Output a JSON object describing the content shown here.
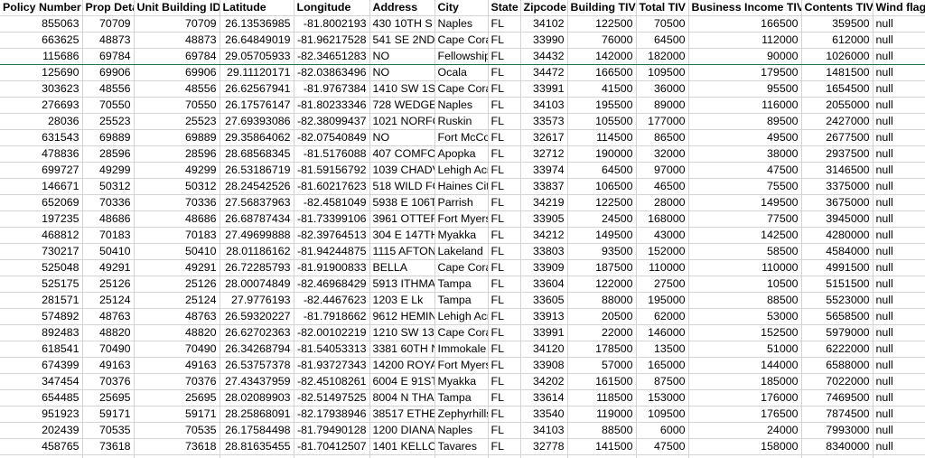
{
  "sheet": {
    "columns": [
      "Policy Number",
      "Prop Deta",
      "Unit Building ID",
      "Latitude",
      "Longitude",
      "Address",
      "City",
      "State",
      "Zipcode",
      "Building TIV",
      "Total TIV",
      "Business Income TIV",
      "Contents TIV",
      "Wind flag"
    ],
    "rows": [
      [
        "855063",
        "70709",
        "70709",
        "26.13536985",
        "-81.8002193",
        "430 10TH S A",
        "Naples",
        "FL",
        "34102",
        "122500",
        "70500",
        "166500",
        "359500",
        "null"
      ],
      [
        "663625",
        "48873",
        "48873",
        "26.64849019",
        "-81.96217528",
        "541 SE 2ND S",
        "Cape Cora",
        "FL",
        "33990",
        "76000",
        "64500",
        "112000",
        "612000",
        "null"
      ],
      [
        "115686",
        "69784",
        "69784",
        "29.05705933",
        "-82.34651283",
        "NO",
        "Fellowship",
        "FL",
        "34432",
        "142000",
        "182000",
        "90000",
        "1026000",
        "null"
      ],
      [
        "125690",
        "69906",
        "69906",
        "29.11120171",
        "-82.03863496",
        "NO",
        "Ocala",
        "FL",
        "34472",
        "166500",
        "109500",
        "179500",
        "1481500",
        "null"
      ],
      [
        "303623",
        "48556",
        "48556",
        "26.62567941",
        "-81.9767384",
        "1410 SW 1ST",
        "Cape Cora",
        "FL",
        "33991",
        "41500",
        "36000",
        "95500",
        "1654500",
        "null"
      ],
      [
        "276693",
        "70550",
        "70550",
        "26.17576147",
        "-81.80233346",
        "728 WEDGE",
        "Naples",
        "FL",
        "34103",
        "195500",
        "89000",
        "116000",
        "2055000",
        "null"
      ],
      [
        "28036",
        "25523",
        "25523",
        "27.69393086",
        "-82.38099437",
        "1021 NORFC",
        "Ruskin",
        "FL",
        "33573",
        "105500",
        "177000",
        "89500",
        "2427000",
        "null"
      ],
      [
        "631543",
        "69889",
        "69889",
        "29.35864062",
        "-82.07540849",
        "NO",
        "Fort McCo",
        "FL",
        "32617",
        "114500",
        "86500",
        "49500",
        "2677500",
        "null"
      ],
      [
        "478836",
        "28596",
        "28596",
        "28.68568345",
        "-81.5176088",
        "407 COMFOI",
        "Apopka",
        "FL",
        "32712",
        "190000",
        "32000",
        "38000",
        "2937500",
        "null"
      ],
      [
        "699727",
        "49299",
        "49299",
        "26.53186719",
        "-81.59156792",
        "1039 CHADV",
        "Lehigh Acr",
        "FL",
        "33974",
        "64500",
        "97000",
        "47500",
        "3146500",
        "null"
      ],
      [
        "146671",
        "50312",
        "50312",
        "28.24542526",
        "-81.60217623",
        "518 WILD FC",
        "Haines City",
        "FL",
        "33837",
        "106500",
        "46500",
        "75500",
        "3375000",
        "null"
      ],
      [
        "652069",
        "70336",
        "70336",
        "27.56837963",
        "-82.4581049",
        "5938 E 106T",
        "Parrish",
        "FL",
        "34219",
        "122500",
        "28000",
        "149500",
        "3675000",
        "null"
      ],
      [
        "197235",
        "48686",
        "48686",
        "26.68787434",
        "-81.73399106",
        "3961 OTTER",
        "Fort Myers",
        "FL",
        "33905",
        "24500",
        "168000",
        "77500",
        "3945000",
        "null"
      ],
      [
        "468812",
        "70183",
        "70183",
        "27.49699888",
        "-82.39764513",
        "304 E 147TH",
        "Myakka",
        "FL",
        "34212",
        "149500",
        "43000",
        "142500",
        "4280000",
        "null"
      ],
      [
        "730217",
        "50410",
        "50410",
        "28.01186162",
        "-81.94244875",
        "1115 AFTON",
        "Lakeland",
        "FL",
        "33803",
        "93500",
        "152000",
        "58500",
        "4584000",
        "null"
      ],
      [
        "525048",
        "49291",
        "49291",
        "26.72285793",
        "-81.91900833",
        "BELLA",
        "Cape Cora",
        "FL",
        "33909",
        "187500",
        "110000",
        "110000",
        "4991500",
        "null"
      ],
      [
        "525175",
        "25126",
        "25126",
        "28.00074849",
        "-82.46968429",
        "5913 ITHMA",
        "Tampa",
        "FL",
        "33604",
        "122000",
        "27500",
        "10500",
        "5151500",
        "null"
      ],
      [
        "281571",
        "25124",
        "25124",
        "27.9776193",
        "-82.4467623",
        "1203 E Lk",
        "Tampa",
        "FL",
        "33605",
        "88000",
        "195000",
        "88500",
        "5523000",
        "null"
      ],
      [
        "574892",
        "48763",
        "48763",
        "26.59320227",
        "-81.7918662",
        "9612 HEMIN",
        "Lehigh Acr",
        "FL",
        "33913",
        "20500",
        "62000",
        "53000",
        "5658500",
        "null"
      ],
      [
        "892483",
        "48820",
        "48820",
        "26.62702363",
        "-82.00102219",
        "1210 SW 13T",
        "Cape Cora",
        "FL",
        "33991",
        "22000",
        "146000",
        "152500",
        "5979000",
        "null"
      ],
      [
        "618541",
        "70490",
        "70490",
        "26.34268794",
        "-81.54053313",
        "3381 60TH N",
        "Immokale",
        "FL",
        "34120",
        "178500",
        "13500",
        "51000",
        "6222000",
        "null"
      ],
      [
        "674399",
        "49163",
        "49163",
        "26.53757378",
        "-81.93727343",
        "14200 ROYA",
        "Fort Myers",
        "FL",
        "33908",
        "57000",
        "165000",
        "144000",
        "6588000",
        "null"
      ],
      [
        "347454",
        "70376",
        "70376",
        "27.43437959",
        "-82.45108261",
        "6004 E 91ST",
        "Myakka",
        "FL",
        "34202",
        "161500",
        "87500",
        "185000",
        "7022000",
        "null"
      ],
      [
        "654485",
        "25695",
        "25695",
        "28.02089903",
        "-82.51497525",
        "8004 N THAI",
        "Tampa",
        "FL",
        "33614",
        "118500",
        "153000",
        "176000",
        "7469500",
        "null"
      ],
      [
        "951923",
        "59171",
        "59171",
        "28.25868091",
        "-82.17938946",
        "38517 ETHEI",
        "Zephyrhills",
        "FL",
        "33540",
        "119000",
        "109500",
        "176500",
        "7874500",
        "null"
      ],
      [
        "202439",
        "70535",
        "70535",
        "26.17584498",
        "-81.79490128",
        "1200 DIANA",
        "Naples",
        "FL",
        "34103",
        "88500",
        "6000",
        "24000",
        "7993000",
        "null"
      ],
      [
        "458765",
        "73618",
        "73618",
        "28.81635455",
        "-81.70412507",
        "1401 KELLO(",
        "Tavares",
        "FL",
        "32778",
        "141500",
        "47500",
        "158000",
        "8340000",
        "null"
      ],
      [
        "",
        "",
        "",
        "",
        "",
        "",
        "",
        "",
        "",
        "",
        "",
        "",
        "",
        ""
      ]
    ]
  }
}
